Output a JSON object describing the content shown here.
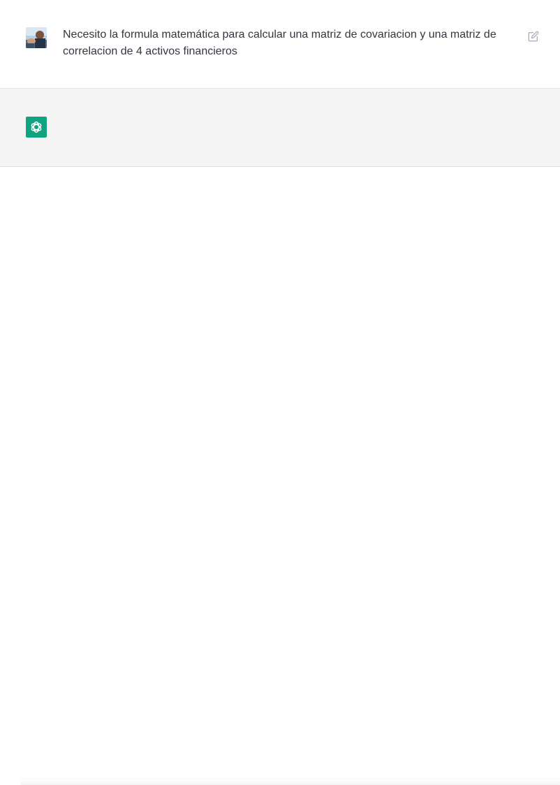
{
  "conversation": {
    "user_message": {
      "text": "Necesito la formula matemática para calcular una matriz de covariacion y una matriz de correlacion de 4 activos financieros",
      "avatar_icon": "user-photo-avatar",
      "edit_icon": "edit-icon"
    },
    "assistant_message": {
      "text": "",
      "avatar_icon": "openai-logo-icon"
    }
  },
  "colors": {
    "user_background": "#ffffff",
    "assistant_background": "#f4f4f4",
    "assistant_accent": "#10a37f",
    "text": "#343541",
    "icon_muted": "#acacbe",
    "divider": "#e5e5e5"
  }
}
